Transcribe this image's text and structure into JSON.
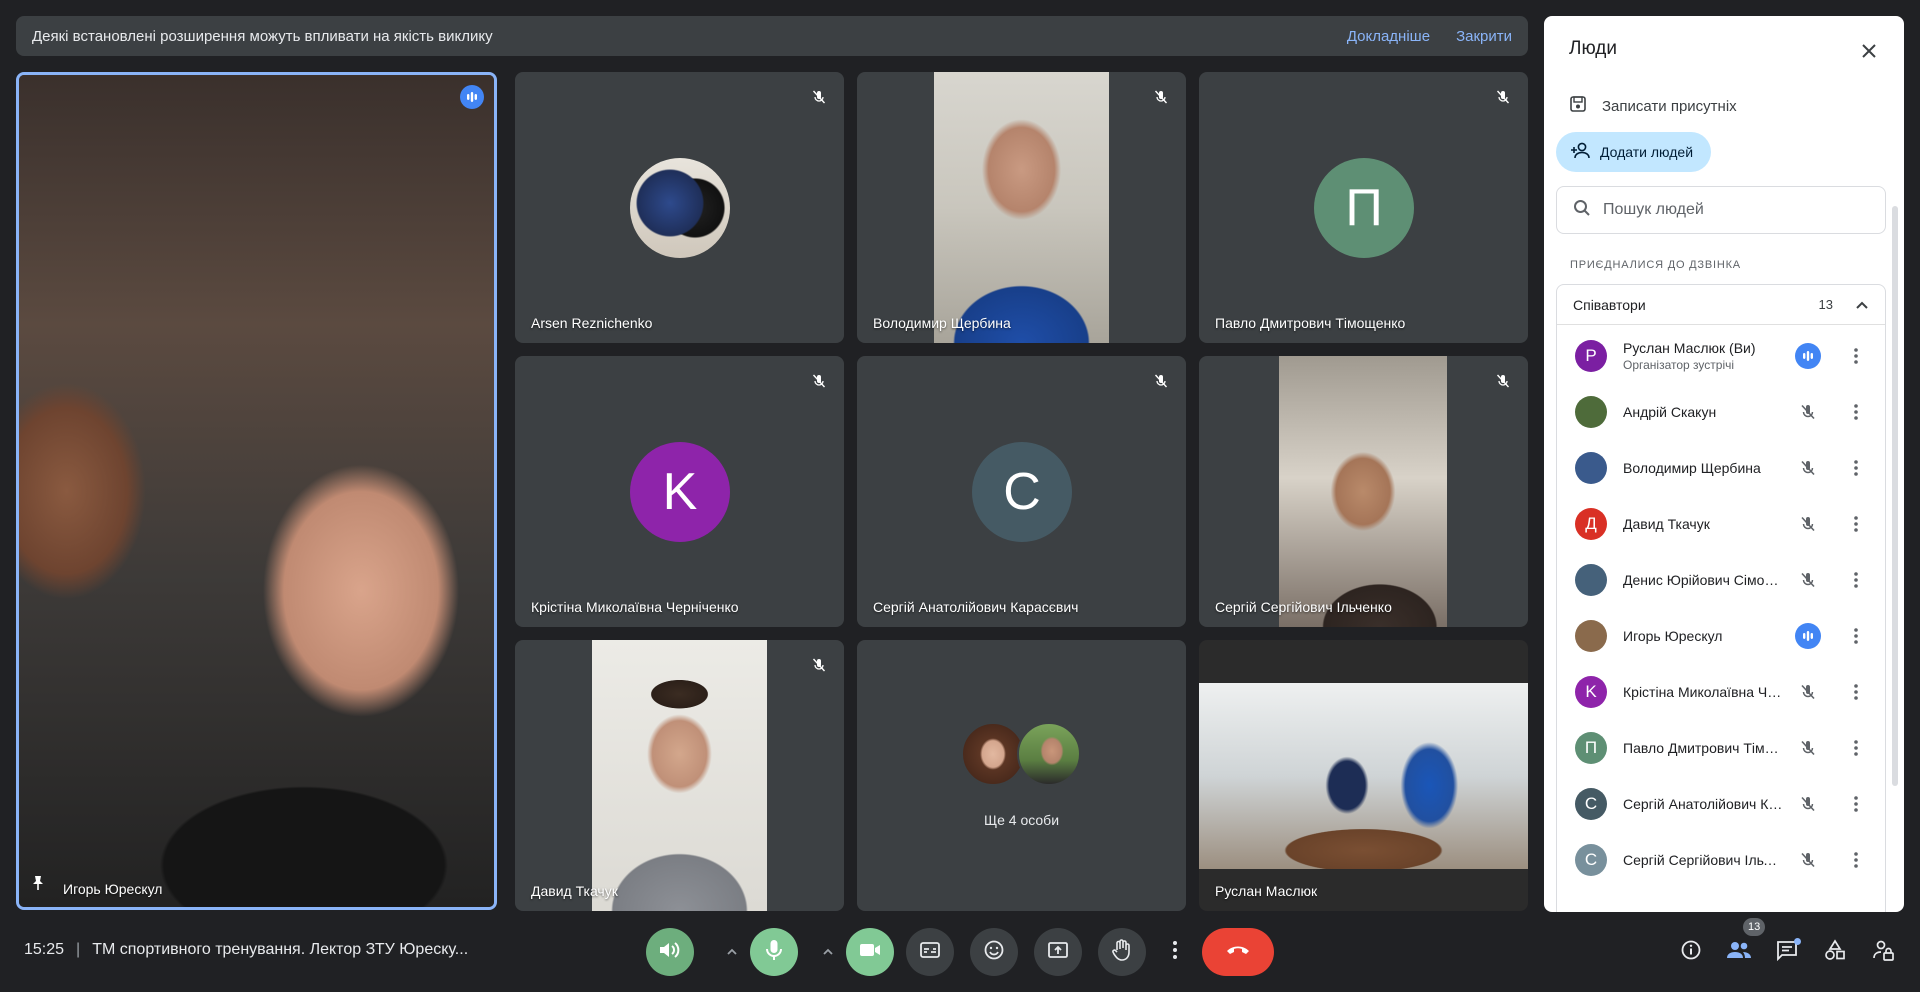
{
  "banner": {
    "message": "Деякі встановлені розширення можуть впливати на якість виклику",
    "learn_more": "Докладніше",
    "close": "Закрити"
  },
  "main_tile": {
    "name": "Игорь Юрескул"
  },
  "tiles": [
    {
      "name": "Arsen Reznichenko",
      "type": "photo-avatar"
    },
    {
      "name": "Володимир Щербина",
      "type": "video"
    },
    {
      "name": "Павло Дмитрович Тімощенко",
      "type": "letter",
      "letter": "П",
      "color": "#5e8f74"
    },
    {
      "name": "Крістіна Миколаївна Черніченко",
      "type": "letter",
      "letter": "K",
      "color": "#8e24aa"
    },
    {
      "name": "Сергій Анатолійович Карасєвич",
      "type": "letter",
      "letter": "C",
      "color": "#455a64"
    },
    {
      "name": "Сергій Сергійович Ільченко",
      "type": "video"
    },
    {
      "name": "Давид Ткачук",
      "type": "video"
    },
    {
      "more_label": "Ще 4 особи",
      "type": "more"
    },
    {
      "name": "Руслан Маслюк",
      "type": "video"
    }
  ],
  "panel": {
    "title": "Люди",
    "record_label": "Записати присутніх",
    "add_people": "Додати людей",
    "search_placeholder": "Пошук людей",
    "section_label": "ПРИЄДНАЛИСЯ ДО ДЗВІНКА",
    "group_name": "Співавтори",
    "group_count": "13",
    "people": [
      {
        "name": "Руслан Маслюк (Ви)",
        "sub": "Організатор зустрічі",
        "avatar_letter": "Р",
        "avatar_color": "#7b1fa2",
        "speaking": true
      },
      {
        "name": "Андрій Скакун",
        "avatar_letter": "",
        "avatar_color": "#4e6b3a",
        "speaking": false
      },
      {
        "name": "Володимир Щербина",
        "avatar_letter": "",
        "avatar_color": "#3a5a8c",
        "speaking": false
      },
      {
        "name": "Давид Ткачук",
        "avatar_letter": "Д",
        "avatar_color": "#d93025",
        "speaking": false
      },
      {
        "name": "Денис Юрійович Сімоненко",
        "avatar_letter": "",
        "avatar_color": "#45617a",
        "speaking": false
      },
      {
        "name": "Игорь Юрескул",
        "avatar_letter": "",
        "avatar_color": "#8a6a4c",
        "speaking": true
      },
      {
        "name": "Крістіна Миколаївна Черніченко",
        "avatar_letter": "K",
        "avatar_color": "#8e24aa",
        "speaking": false
      },
      {
        "name": "Павло Дмитрович Тімощенко",
        "avatar_letter": "П",
        "avatar_color": "#5e8f74",
        "speaking": false
      },
      {
        "name": "Сергій Анатолійович Карасєвич",
        "avatar_letter": "C",
        "avatar_color": "#455a64",
        "speaking": false
      },
      {
        "name": "Сергій Сергійович Ільченко",
        "avatar_letter": "C",
        "avatar_color": "#78909c",
        "speaking": false
      }
    ]
  },
  "bottom": {
    "time": "15:25",
    "meeting_title": "ТМ спортивного тренування. Лектор ЗТУ Юреску...",
    "people_badge": "13"
  },
  "colors": {
    "accent": "#8ab4f8",
    "end_call": "#ea4335",
    "mic_on": "#81c995"
  }
}
